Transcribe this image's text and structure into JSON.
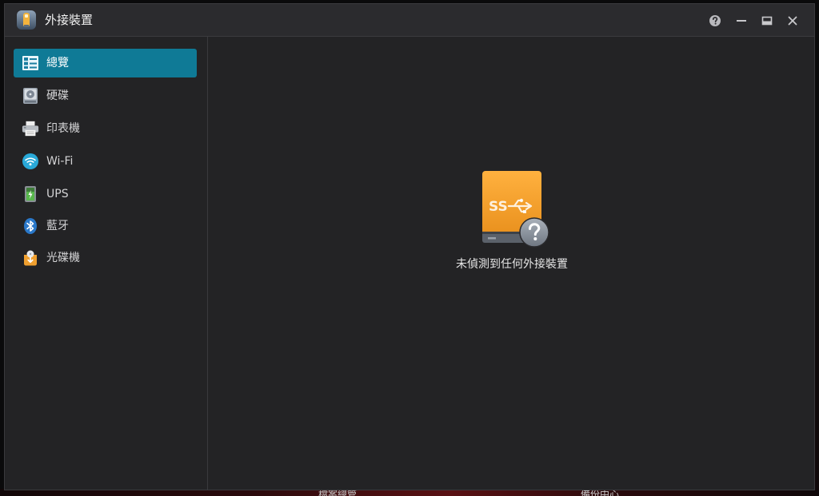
{
  "window": {
    "title": "外接裝置"
  },
  "titlebar_buttons": [
    {
      "name": "help",
      "icon": "help-icon"
    },
    {
      "name": "minimize",
      "icon": "minimize-icon"
    },
    {
      "name": "maximize",
      "icon": "maximize-icon"
    },
    {
      "name": "close",
      "icon": "close-icon"
    }
  ],
  "sidebar": {
    "items": [
      {
        "label": "總覽",
        "icon": "overview-list-icon",
        "active": true
      },
      {
        "label": "硬碟",
        "icon": "hard-disk-icon",
        "active": false
      },
      {
        "label": "印表機",
        "icon": "printer-icon",
        "active": false
      },
      {
        "label": "Wi-Fi",
        "icon": "wifi-icon",
        "active": false
      },
      {
        "label": "UPS",
        "icon": "ups-battery-icon",
        "active": false
      },
      {
        "label": "藍牙",
        "icon": "bluetooth-icon",
        "active": false
      },
      {
        "label": "光碟機",
        "icon": "optical-drive-icon",
        "active": false
      }
    ]
  },
  "main": {
    "empty_icon": "usb-drive-unknown-icon",
    "empty_message": "未偵測到任何外接裝置"
  },
  "desktop": {
    "partial_labels": [
      "檔案總管",
      "備份中心"
    ]
  },
  "colors": {
    "accent": "#0f7a96",
    "window_bg": "#232325",
    "titlebar_bg": "#2b2b2e",
    "usb_orange": "#f0a030"
  }
}
